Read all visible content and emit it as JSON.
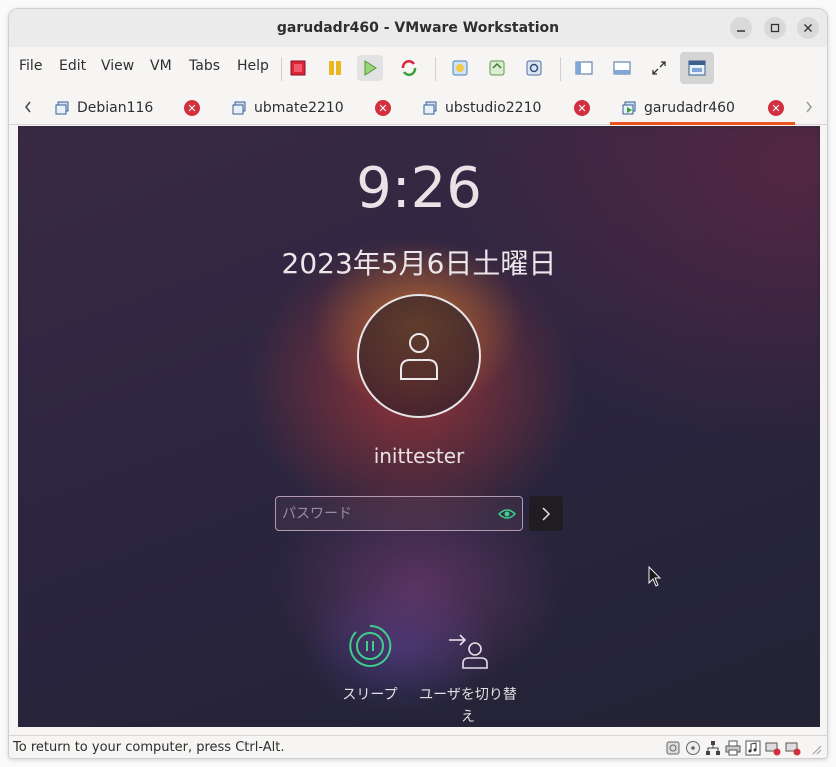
{
  "window": {
    "title": "garudadr460 - VMware Workstation"
  },
  "menu": [
    "File",
    "Edit",
    "View",
    "VM",
    "Tabs",
    "Help"
  ],
  "tabs": [
    {
      "label": "Debian116",
      "active": false
    },
    {
      "label": "ubmate2210",
      "active": false
    },
    {
      "label": "ubstudio2210",
      "active": false
    },
    {
      "label": "garudadr460",
      "active": true
    }
  ],
  "lockscreen": {
    "time": "9:26",
    "date": "2023年5月6日土曜日",
    "username": "inittester",
    "password_placeholder": "パスワード",
    "actions": [
      {
        "label": "スリープ",
        "icon": "sleep-icon"
      },
      {
        "label": "ユーザを切り替え",
        "icon": "switch-user-icon"
      }
    ]
  },
  "statusbar": {
    "text": "To return to your computer, press Ctrl-Alt."
  },
  "colors": {
    "accent": "#e95420",
    "close": "#d32f3f",
    "sleep_green": "#3ecf8e"
  }
}
